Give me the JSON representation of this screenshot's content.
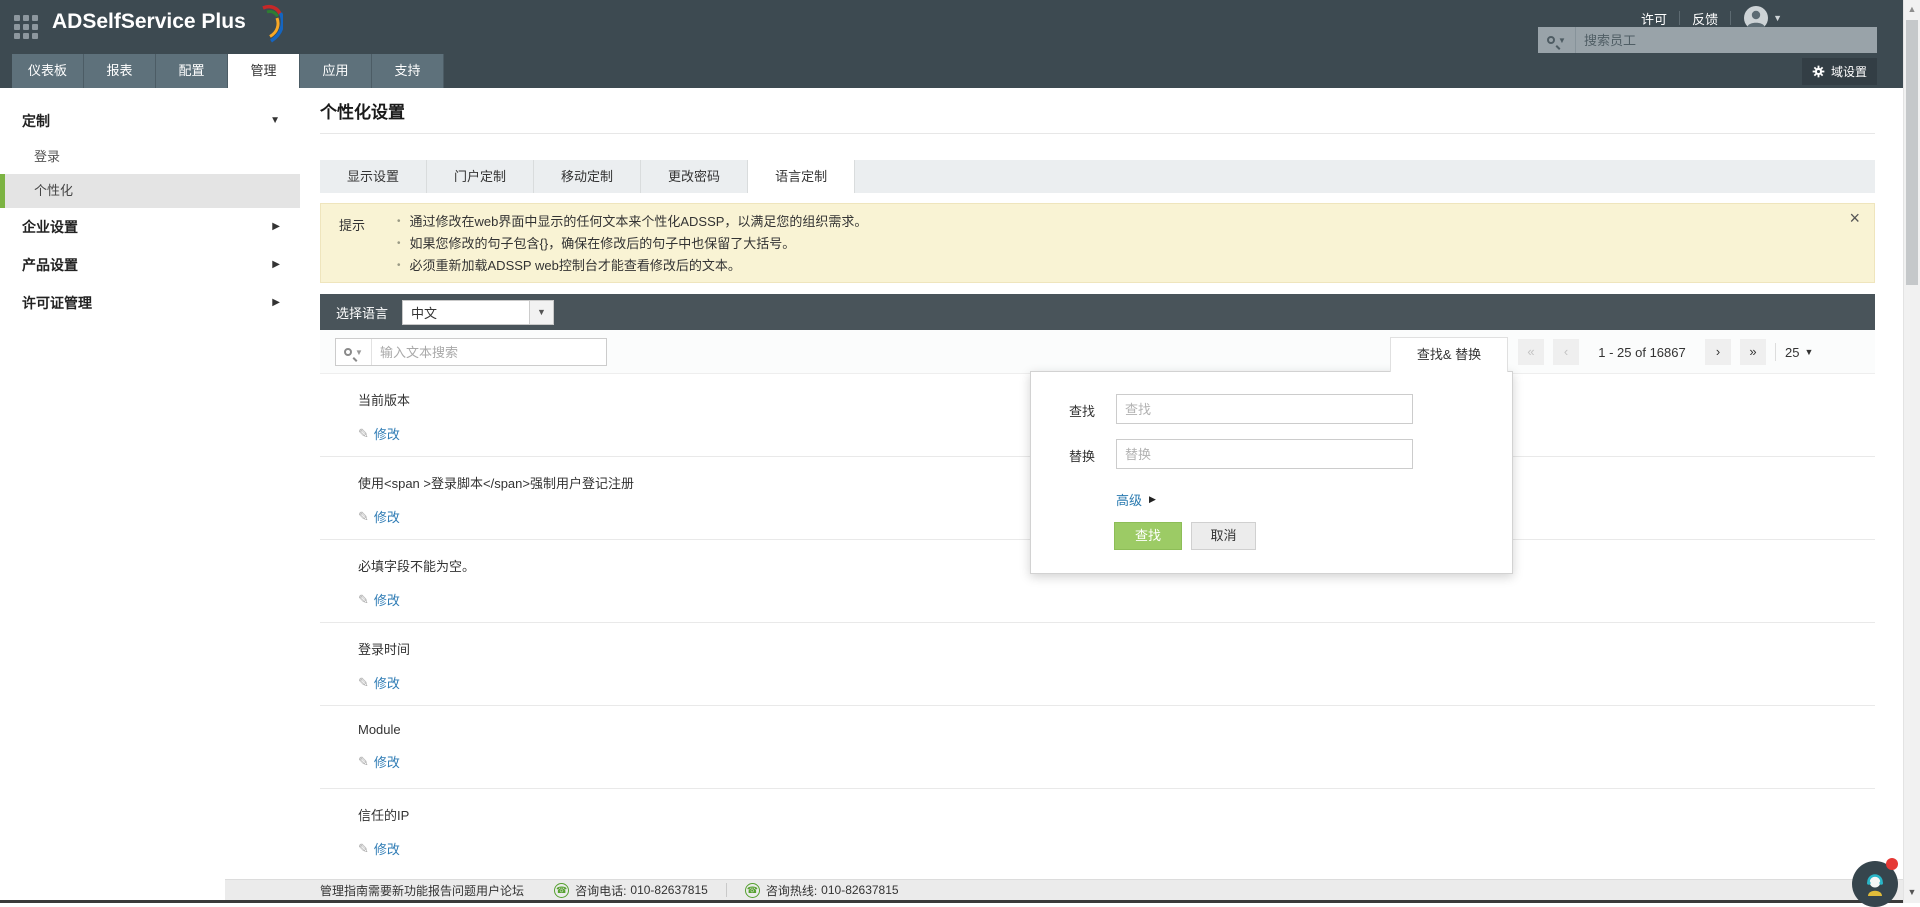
{
  "colors": {
    "header_bg": "#3d4a51",
    "nav_tab_bg": "#5e717b",
    "accent_green": "#7cb342",
    "link_blue": "#2f7cb5",
    "tip_bg": "#f9f3d4",
    "lang_bar_bg": "#49545a",
    "find_button_green": "#9ccb65"
  },
  "header": {
    "app_title": "ADSelfService Plus",
    "license_link": "许可",
    "feedback_link": "反馈",
    "employee_search_placeholder": "搜索员工",
    "domain_settings_label": "域设置"
  },
  "nav": {
    "tabs": [
      {
        "label": "仪表板"
      },
      {
        "label": "报表"
      },
      {
        "label": "配置"
      },
      {
        "label": "管理"
      },
      {
        "label": "应用"
      },
      {
        "label": "支持"
      }
    ]
  },
  "sidebar": {
    "items": [
      {
        "label": "定制"
      },
      {
        "label": "登录"
      },
      {
        "label": "个性化"
      },
      {
        "label": "企业设置"
      },
      {
        "label": "产品设置"
      },
      {
        "label": "许可证管理"
      }
    ]
  },
  "page": {
    "title": "个性化设置",
    "tabs": [
      {
        "label": "显示设置"
      },
      {
        "label": "门户定制"
      },
      {
        "label": "移动定制"
      },
      {
        "label": "更改密码"
      },
      {
        "label": "语言定制"
      }
    ],
    "tip": {
      "label": "提示",
      "bullets": [
        {
          "text": "通过修改在web界面中显示的任何文本来个性化ADSSP，以满足您的组织需求。"
        },
        {
          "text": "如果您修改的句子包含{}，确保在修改后的句子中也保留了大括号。"
        },
        {
          "text": "必须重新加载ADSSP web控制台才能查看修改后的文本。"
        }
      ]
    },
    "language_select": {
      "label": "选择语言",
      "value": "中文"
    },
    "text_search_placeholder": "输入文本搜索",
    "find_replace_tab": "查找& 替换",
    "pagination": {
      "range_text": "1 - 25 of 16867",
      "page_size": "25"
    },
    "entries": [
      {
        "label": "当前版本",
        "action": "修改"
      },
      {
        "label": "使用<span >登录脚本</span>强制用户登记注册",
        "action": "修改"
      },
      {
        "label": "必填字段不能为空。",
        "action": "修改"
      },
      {
        "label": "登录时间",
        "action": "修改"
      },
      {
        "label": "Module",
        "action": "修改"
      },
      {
        "label": "信任的IP",
        "action": "修改"
      }
    ]
  },
  "find_replace_popup": {
    "find_label": "查找",
    "find_placeholder": "查找",
    "replace_label": "替换",
    "replace_placeholder": "替换",
    "advanced_label": "高级",
    "find_button": "查找",
    "cancel_button": "取消"
  },
  "footer": {
    "links": [
      {
        "label": "管理指南"
      },
      {
        "label": "需要新功能"
      },
      {
        "label": "报告问题"
      },
      {
        "label": "用户论坛"
      }
    ],
    "phone_label": "咨询电话:",
    "phone_number": "010-82637815",
    "hotline_label": "咨询热线:",
    "hotline_number": "010-82637815"
  }
}
